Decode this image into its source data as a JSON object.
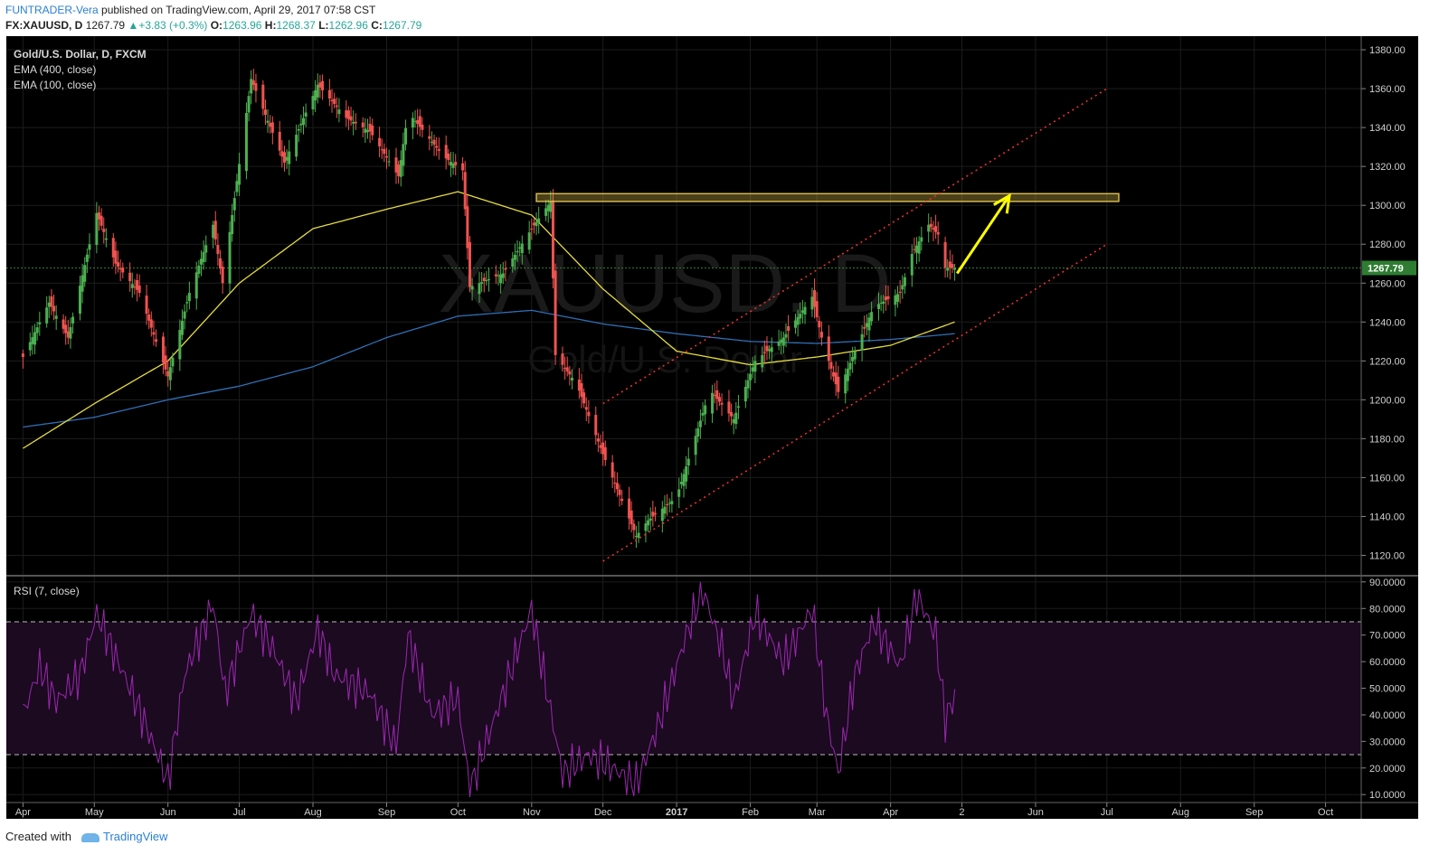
{
  "header": {
    "author": "FUNTRADER-Vera",
    "published": "published on TradingView.com, April 29, 2017 07:58 CST",
    "symbol": "FX:XAUUSD, D",
    "last": "1267.79",
    "change": "+3.83 (+0.3%)",
    "o_label": "O:",
    "o_value": "1263.96",
    "h_label": "H:",
    "h_value": "1268.37",
    "l_label": "L:",
    "l_value": "1262.96",
    "c_label": "C:",
    "c_value": "1267.79"
  },
  "legend": {
    "title": "Gold/U.S. Dollar, D, FXCM",
    "ema400": "EMA (400, close)",
    "ema100": "EMA (100, close)",
    "rsi": "RSI (7, close)"
  },
  "watermark": {
    "symbol": "XAUUSD, D",
    "name": "Gold/U.S. Dollar"
  },
  "footer": {
    "created": "Created with",
    "brand": "TradingView"
  },
  "colors": {
    "background": "#000000",
    "up_candle": "#4caf50",
    "down_candle": "#ef5350",
    "ema100": "#e6dc3c",
    "ema400": "#2f6fb5",
    "rsi_line": "#9c27b0",
    "rsi_band": "#1b0a20",
    "channel": "#ff3030",
    "resistance": "#d4b84a",
    "arrow": "#ffff00",
    "price_line": "#2e7d32"
  },
  "chart_data": [
    {
      "type": "candlestick",
      "title": "Gold/U.S. Dollar, D, FXCM",
      "x_tick_labels": [
        "Apr",
        "May",
        "Jun",
        "Jul",
        "Aug",
        "Sep",
        "Oct",
        "Nov",
        "Dec",
        "2017",
        "Feb",
        "Mar",
        "Apr",
        "2",
        "Jun",
        "Jul",
        "Aug",
        "Sep",
        "Oct"
      ],
      "y_tick_labels": [
        "1120.00",
        "1140.00",
        "1160.00",
        "1180.00",
        "1200.00",
        "1220.00",
        "1240.00",
        "1260.00",
        "1280.00",
        "1300.00",
        "1320.00",
        "1340.00",
        "1360.00",
        "1380.00"
      ],
      "ylim": [
        1110,
        1387
      ],
      "last_price": 1267.79,
      "last_price_label": "1267.79",
      "price_path": [
        [
          "2016-04-01",
          1222
        ],
        [
          "2016-04-12",
          1250
        ],
        [
          "2016-04-20",
          1232
        ],
        [
          "2016-05-02",
          1296
        ],
        [
          "2016-05-10",
          1270
        ],
        [
          "2016-05-20",
          1255
        ],
        [
          "2016-06-01",
          1212
        ],
        [
          "2016-06-10",
          1255
        ],
        [
          "2016-06-20",
          1290
        ],
        [
          "2016-06-24",
          1260
        ],
        [
          "2016-07-06",
          1365
        ],
        [
          "2016-07-20",
          1322
        ],
        [
          "2016-08-03",
          1362
        ],
        [
          "2016-08-15",
          1345
        ],
        [
          "2016-08-25",
          1338
        ],
        [
          "2016-09-06",
          1315
        ],
        [
          "2016-09-10",
          1348
        ],
        [
          "2016-09-25",
          1325
        ],
        [
          "2016-10-03",
          1318
        ],
        [
          "2016-10-06",
          1258
        ],
        [
          "2016-10-20",
          1265
        ],
        [
          "2016-11-01",
          1288
        ],
        [
          "2016-11-09",
          1302
        ],
        [
          "2016-11-11",
          1223
        ],
        [
          "2016-11-20",
          1208
        ],
        [
          "2016-12-01",
          1172
        ],
        [
          "2016-12-15",
          1130
        ],
        [
          "2016-12-20",
          1138
        ],
        [
          "2017-01-01",
          1150
        ],
        [
          "2017-01-15",
          1205
        ],
        [
          "2017-01-25",
          1190
        ],
        [
          "2017-02-03",
          1220
        ],
        [
          "2017-02-15",
          1232
        ],
        [
          "2017-02-27",
          1253
        ],
        [
          "2017-03-03",
          1232
        ],
        [
          "2017-03-10",
          1204
        ],
        [
          "2017-03-18",
          1228
        ],
        [
          "2017-03-25",
          1248
        ],
        [
          "2017-04-05",
          1255
        ],
        [
          "2017-04-10",
          1275
        ],
        [
          "2017-04-17",
          1290
        ],
        [
          "2017-04-21",
          1285
        ],
        [
          "2017-04-24",
          1268
        ],
        [
          "2017-04-28",
          1267.79
        ]
      ],
      "ema100_path": [
        [
          "2016-04-01",
          1175
        ],
        [
          "2016-05-01",
          1198
        ],
        [
          "2016-06-01",
          1220
        ],
        [
          "2016-07-01",
          1260
        ],
        [
          "2016-08-01",
          1288
        ],
        [
          "2016-09-01",
          1298
        ],
        [
          "2016-10-01",
          1307
        ],
        [
          "2016-11-01",
          1295
        ],
        [
          "2016-12-01",
          1257
        ],
        [
          "2017-01-01",
          1225
        ],
        [
          "2017-02-01",
          1218
        ],
        [
          "2017-03-01",
          1222
        ],
        [
          "2017-04-01",
          1228
        ],
        [
          "2017-04-28",
          1240
        ]
      ],
      "ema400_path": [
        [
          "2016-04-01",
          1186
        ],
        [
          "2016-05-01",
          1191
        ],
        [
          "2016-06-01",
          1200
        ],
        [
          "2016-07-01",
          1207
        ],
        [
          "2016-08-01",
          1217
        ],
        [
          "2016-09-01",
          1232
        ],
        [
          "2016-10-01",
          1243
        ],
        [
          "2016-11-01",
          1246
        ],
        [
          "2016-12-01",
          1239
        ],
        [
          "2017-01-01",
          1234
        ],
        [
          "2017-02-01",
          1230
        ],
        [
          "2017-03-01",
          1229
        ],
        [
          "2017-04-01",
          1231
        ],
        [
          "2017-04-28",
          1234
        ]
      ],
      "resistance_zone": {
        "start": "2016-11-03",
        "end": "2017-07-06",
        "low": 1302,
        "high": 1306
      },
      "channel_upper": [
        [
          "2016-12-01",
          1198
        ],
        [
          "2017-07-01",
          1360
        ]
      ],
      "channel_lower": [
        [
          "2016-12-01",
          1117
        ],
        [
          "2017-07-01",
          1280
        ]
      ],
      "arrow": [
        [
          "2017-04-29",
          1265
        ],
        [
          "2017-05-21",
          1305
        ]
      ]
    },
    {
      "type": "line",
      "title": "RSI (7, close)",
      "y_tick_labels": [
        "10.0000",
        "20.0000",
        "30.0000",
        "40.0000",
        "50.0000",
        "60.0000",
        "70.0000",
        "80.0000",
        "90.0000"
      ],
      "ylim": [
        7,
        92
      ],
      "bands": [
        25,
        75
      ],
      "series": [
        {
          "values_path": [
            [
              "2016-04-01",
              40
            ],
            [
              "2016-04-08",
              58
            ],
            [
              "2016-04-15",
              45
            ],
            [
              "2016-04-25",
              55
            ],
            [
              "2016-05-02",
              78
            ],
            [
              "2016-05-10",
              62
            ],
            [
              "2016-05-20",
              42
            ],
            [
              "2016-06-01",
              15
            ],
            [
              "2016-06-08",
              55
            ],
            [
              "2016-06-20",
              82
            ],
            [
              "2016-06-25",
              48
            ],
            [
              "2016-07-06",
              78
            ],
            [
              "2016-07-15",
              65
            ],
            [
              "2016-07-25",
              45
            ],
            [
              "2016-08-03",
              72
            ],
            [
              "2016-08-10",
              55
            ],
            [
              "2016-08-25",
              48
            ],
            [
              "2016-09-05",
              28
            ],
            [
              "2016-09-10",
              70
            ],
            [
              "2016-09-20",
              40
            ],
            [
              "2016-10-01",
              46
            ],
            [
              "2016-10-06",
              12
            ],
            [
              "2016-10-20",
              48
            ],
            [
              "2016-11-01",
              80
            ],
            [
              "2016-11-05",
              60
            ],
            [
              "2016-11-14",
              18
            ],
            [
              "2016-11-25",
              25
            ],
            [
              "2016-12-05",
              20
            ],
            [
              "2016-12-15",
              14
            ],
            [
              "2016-12-25",
              38
            ],
            [
              "2017-01-05",
              70
            ],
            [
              "2017-01-12",
              87
            ],
            [
              "2017-01-20",
              65
            ],
            [
              "2017-01-25",
              45
            ],
            [
              "2017-02-03",
              78
            ],
            [
              "2017-02-15",
              60
            ],
            [
              "2017-02-27",
              80
            ],
            [
              "2017-03-05",
              40
            ],
            [
              "2017-03-10",
              18
            ],
            [
              "2017-03-17",
              55
            ],
            [
              "2017-03-25",
              75
            ],
            [
              "2017-04-05",
              58
            ],
            [
              "2017-04-12",
              85
            ],
            [
              "2017-04-20",
              70
            ],
            [
              "2017-04-24",
              38
            ],
            [
              "2017-04-28",
              47
            ]
          ]
        }
      ]
    }
  ]
}
